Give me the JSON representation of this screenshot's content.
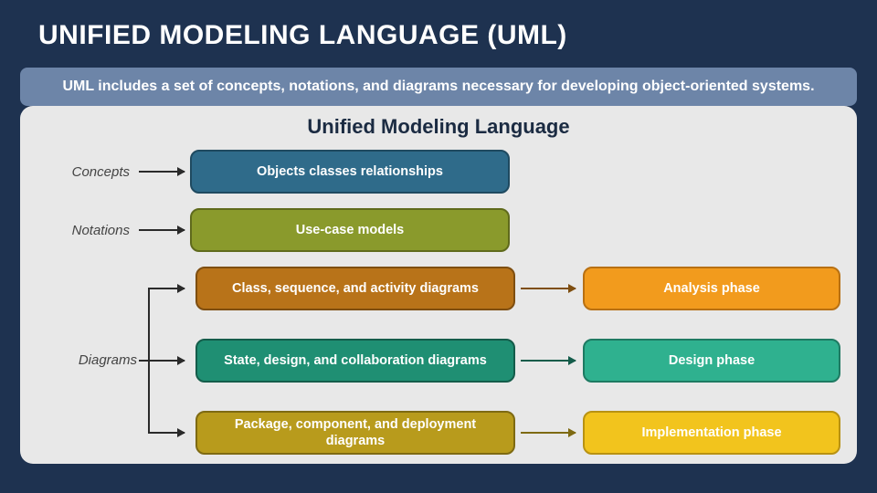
{
  "title": "UNIFIED MODELING LANGUAGE (UML)",
  "subtitle": "UML includes a set of concepts, notations, and diagrams necessary for developing object-oriented systems.",
  "panel_heading": "Unified Modeling Language",
  "labels": {
    "concepts": "Concepts",
    "notations": "Notations",
    "diagrams": "Diagrams"
  },
  "boxes": {
    "concepts": "Objects classes relationships",
    "notations": "Use-case models",
    "diag1": "Class, sequence, and activity diagrams",
    "diag2": "State, design, and collaboration diagrams",
    "diag3": "Package, component, and deployment diagrams",
    "phase1": "Analysis phase",
    "phase2": "Design phase",
    "phase3": "Implementation phase"
  }
}
